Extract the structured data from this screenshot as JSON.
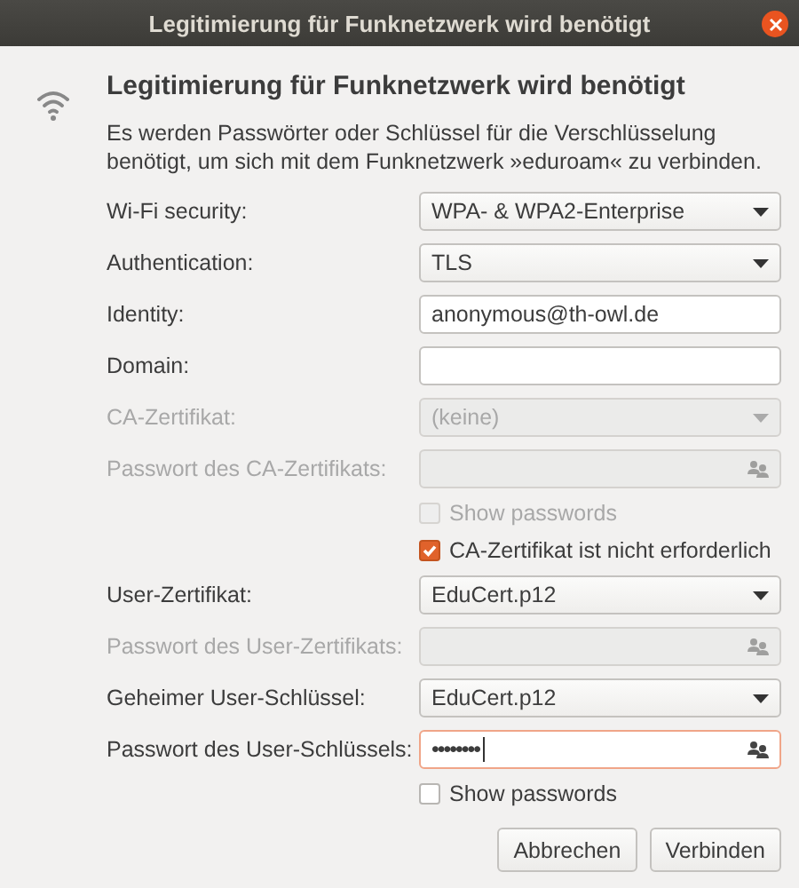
{
  "window": {
    "title": "Legitimierung für Funknetzwerk wird benötigt"
  },
  "heading": "Legitimierung für Funknetzwerk wird benötigt",
  "message": "Es werden Passwörter oder Schlüssel für die Verschlüsselung benötigt, um sich mit dem Funknetzwerk »eduroam« zu verbinden.",
  "rows": [
    {
      "kind": "select",
      "label": "Wi-Fi security:",
      "value": "WPA- & WPA2-Enterprise",
      "disabled": false
    },
    {
      "kind": "select",
      "label": "Authentication:",
      "value": "TLS",
      "disabled": false
    },
    {
      "kind": "text",
      "label": "Identity:",
      "value": "anonymous@th-owl.de",
      "disabled": false
    },
    {
      "kind": "text",
      "label": "Domain:",
      "disabled": false
    },
    {
      "kind": "select",
      "label": "CA-Zertifikat:",
      "value": "(keine)",
      "disabled": true
    },
    {
      "kind": "password",
      "label": "Passwort des CA-Zertifikats:",
      "disabled": true,
      "focused": false
    },
    {
      "kind": "checkbox",
      "label": "Show passwords",
      "checked": false,
      "disabled": true
    },
    {
      "kind": "checkbox",
      "label": "CA-Zertifikat ist nicht erforderlich",
      "checked": true,
      "disabled": false
    },
    {
      "kind": "select",
      "label": "User-Zertifikat:",
      "value": "EduCert.p12",
      "disabled": false
    },
    {
      "kind": "password",
      "label": "Passwort des User-Zertifikats:",
      "disabled": true,
      "focused": false
    },
    {
      "kind": "select",
      "label": "Geheimer User-Schlüssel:",
      "value": "EduCert.p12",
      "disabled": false
    },
    {
      "kind": "password",
      "label": "Passwort des User-Schlüssels:",
      "masked_text": "••••••••",
      "disabled": false,
      "focused": true
    },
    {
      "kind": "checkbox",
      "label": "Show passwords",
      "checked": false,
      "disabled": false
    }
  ],
  "buttons": [
    "Abbrechen",
    "Verbinden"
  ]
}
